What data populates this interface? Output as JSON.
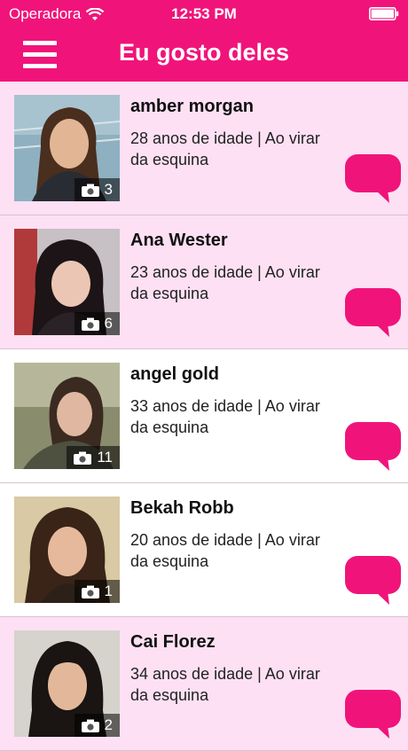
{
  "status_bar": {
    "carrier": "Operadora",
    "time": "12:53 PM"
  },
  "nav": {
    "title": "Eu gosto deles"
  },
  "colors": {
    "accent": "#f0147a",
    "row_highlight": "#fde0f4"
  },
  "profiles": [
    {
      "name": "amber morgan",
      "desc": "28 anos de idade | Ao virar da esquina",
      "photos": "3",
      "icon": "camera-icon"
    },
    {
      "name": "Ana Wester",
      "desc": "23 anos de idade | Ao virar da esquina",
      "photos": "6",
      "icon": "camera-icon"
    },
    {
      "name": "angel gold",
      "desc": "33 anos de idade | Ao virar da esquina",
      "photos": "11",
      "icon": "camera-icon"
    },
    {
      "name": "Bekah Robb",
      "desc": "20 anos de idade | Ao virar da esquina",
      "photos": "1",
      "icon": "camera-icon"
    },
    {
      "name": "Cai Florez",
      "desc": "34 anos de idade | Ao virar da esquina",
      "photos": "2",
      "icon": "camera-icon"
    }
  ]
}
